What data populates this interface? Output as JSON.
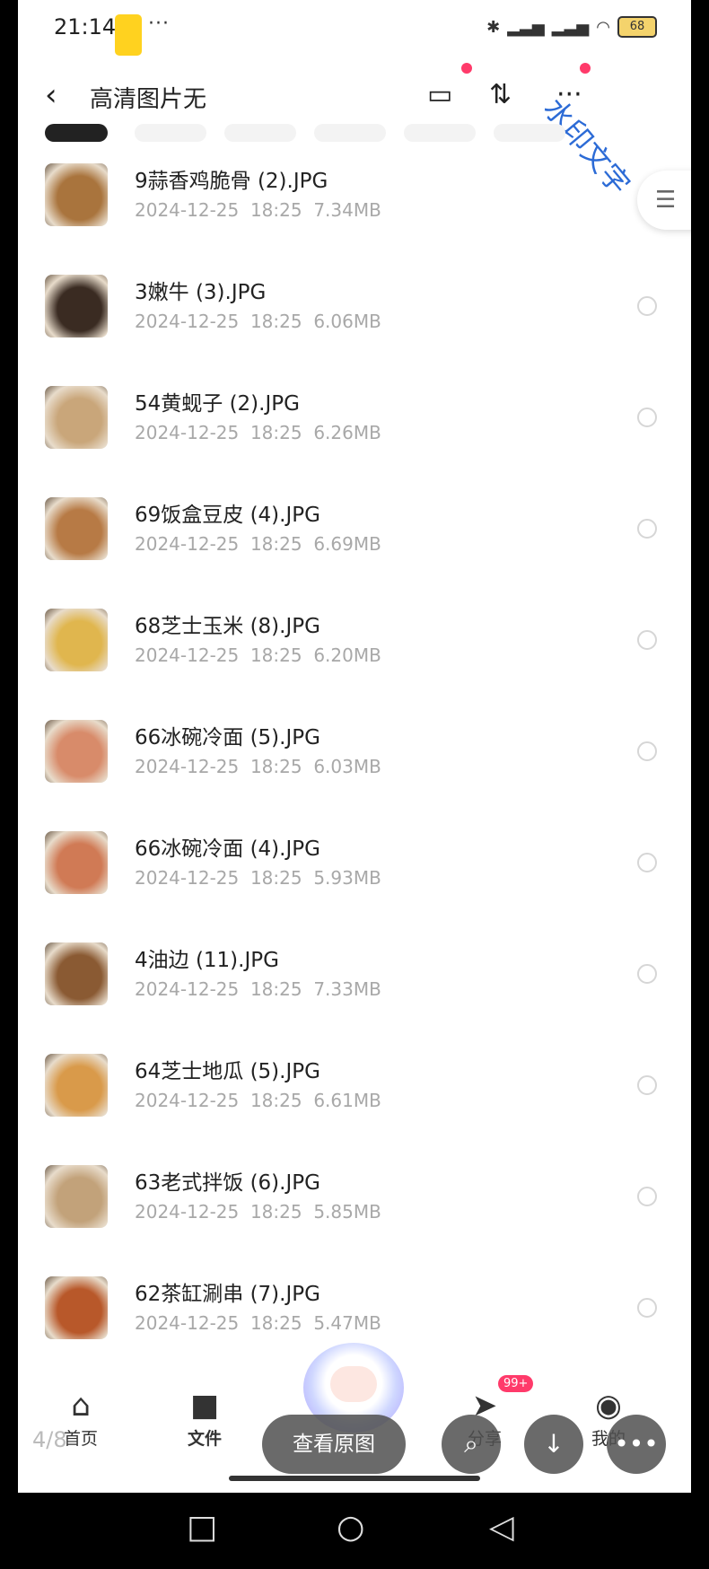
{
  "status_bar": {
    "time": "21:14",
    "dots": "···",
    "battery": "68"
  },
  "header": {
    "title": "高清图片无",
    "watermark": "水印文字"
  },
  "files": [
    {
      "name": "9蒜香鸡脆骨 (2).JPG",
      "date": "2024-12-25",
      "time": "18:25",
      "size": "7.34MB",
      "thumb_color": "#a9743d"
    },
    {
      "name": "3嫩牛 (3).JPG",
      "date": "2024-12-25",
      "time": "18:25",
      "size": "6.06MB",
      "thumb_color": "#3a2b22"
    },
    {
      "name": "54黄蚬子 (2).JPG",
      "date": "2024-12-25",
      "time": "18:25",
      "size": "6.26MB",
      "thumb_color": "#c9a67a"
    },
    {
      "name": "69饭盒豆皮 (4).JPG",
      "date": "2024-12-25",
      "time": "18:25",
      "size": "6.69MB",
      "thumb_color": "#b77a45"
    },
    {
      "name": "68芝士玉米 (8).JPG",
      "date": "2024-12-25",
      "time": "18:25",
      "size": "6.20MB",
      "thumb_color": "#e0b64e"
    },
    {
      "name": "66冰碗冷面 (5).JPG",
      "date": "2024-12-25",
      "time": "18:25",
      "size": "6.03MB",
      "thumb_color": "#d88b6a"
    },
    {
      "name": "66冰碗冷面 (4).JPG",
      "date": "2024-12-25",
      "time": "18:25",
      "size": "5.93MB",
      "thumb_color": "#d07a55"
    },
    {
      "name": "4油边 (11).JPG",
      "date": "2024-12-25",
      "time": "18:25",
      "size": "7.33MB",
      "thumb_color": "#8a5a33"
    },
    {
      "name": "64芝士地瓜 (5).JPG",
      "date": "2024-12-25",
      "time": "18:25",
      "size": "6.61MB",
      "thumb_color": "#d99a4a"
    },
    {
      "name": "63老式拌饭 (6).JPG",
      "date": "2024-12-25",
      "time": "18:25",
      "size": "5.85MB",
      "thumb_color": "#c2a27a"
    },
    {
      "name": "62茶缸涮串 (7).JPG",
      "date": "2024-12-25",
      "time": "18:25",
      "size": "5.47MB",
      "thumb_color": "#b8582a"
    }
  ],
  "bottom_nav": {
    "home": "首页",
    "files": "文件",
    "share": "分享",
    "mine": "我的",
    "badge": "99+"
  },
  "preview": {
    "counter": "4/8",
    "view_original": "查看原图"
  }
}
